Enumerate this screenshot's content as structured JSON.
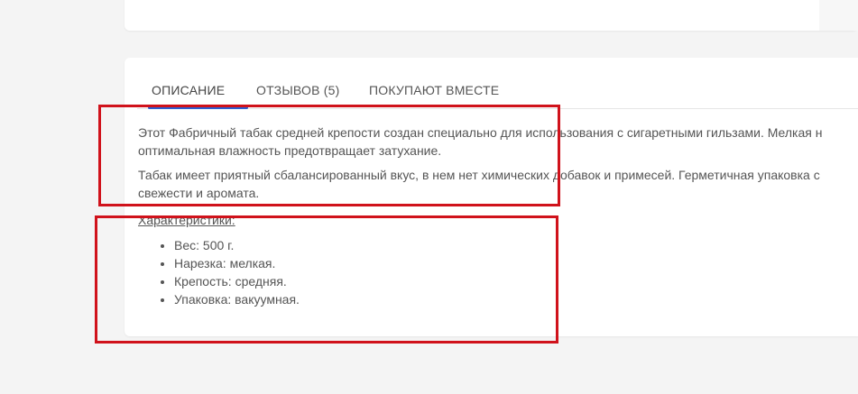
{
  "tabs": [
    {
      "label": "ОПИСАНИЕ",
      "active": true
    },
    {
      "label": "ОТЗЫВОВ (5)",
      "active": false
    },
    {
      "label": "ПОКУПАЮТ ВМЕСТЕ",
      "active": false
    }
  ],
  "description": {
    "paragraph1_line1": "Этот Фабричный табак средней крепости создан специально для использования с сигаретными гильзами. Мелкая н",
    "paragraph1_line2": "оптимальная влажность предотвращает затухание.",
    "paragraph2_line1": "Табак имеет приятный сбалансированный вкус, в нем нет химических добавок и примесей. Герметичная упаковка с",
    "paragraph2_line2": "свежести и аромата."
  },
  "characteristics": {
    "heading": "Характеристики:",
    "items": [
      "Вес: 500 г.",
      "Нарезка: мелкая.",
      "Крепость: средняя.",
      "Упаковка: вакуумная."
    ]
  },
  "colors": {
    "active_tab_underline": "#2f5fd0",
    "annotation_box": "#d0121b"
  }
}
